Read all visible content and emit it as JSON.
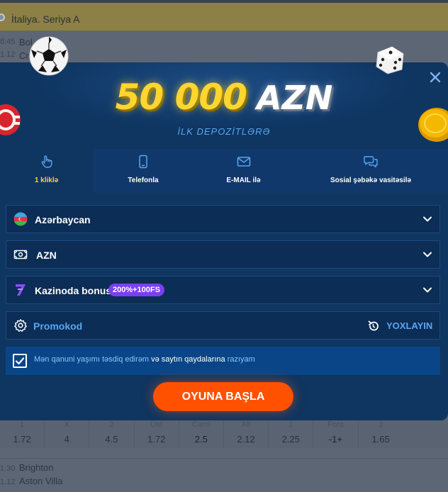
{
  "background": {
    "league": "İtaliya. Seriya A",
    "match1": {
      "times": [
        "8:45",
        "1.12"
      ],
      "teams": [
        "Bol",
        "Cr"
      ]
    },
    "odds": [
      {
        "head": "1",
        "value": "1.72"
      },
      {
        "head": "X",
        "value": "4"
      },
      {
        "head": "2",
        "value": "4.5"
      },
      {
        "head": "Üst",
        "value": "1.72"
      },
      {
        "head": "Cəmi",
        "value": "2.5"
      },
      {
        "head": "Alt",
        "value": "2.12"
      },
      {
        "head": "1",
        "value": "2.25"
      },
      {
        "head": "Fora",
        "value": "-1+"
      },
      {
        "head": "2",
        "value": "1.65"
      }
    ],
    "match2": {
      "times": [
        "1:30",
        "1.12"
      ],
      "teams": [
        "Brighton",
        "Aston Villa"
      ]
    }
  },
  "modal": {
    "close_icon": "close-icon",
    "headline": {
      "amount": "50 000",
      "currency": "AZN"
    },
    "subhead": "İLK DEPOZİTLƏRƏ",
    "tabs": [
      {
        "label": "1 kliklə",
        "icon": "hand-pointer-icon",
        "active": true
      },
      {
        "label": "Telefonla",
        "icon": "phone-icon",
        "active": false
      },
      {
        "label": "E-MAIL ilə",
        "icon": "mail-icon",
        "active": false
      },
      {
        "label": "Sosial şəbəkə vasitəsilə",
        "icon": "chat-icon",
        "active": false
      }
    ],
    "country": {
      "value": "Azərbaycan",
      "icon": "azerbaijan-flag-icon"
    },
    "currency_select": {
      "value": "AZN",
      "icon": "banknote-icon"
    },
    "bonus": {
      "label": "Kazinoda bonus",
      "badge": "200%+100FS",
      "icon": "casino-7-icon"
    },
    "promo": {
      "placeholder": "Promokod",
      "check_label": "YOXLAYIN",
      "icon": "gear-icon"
    },
    "consent": {
      "checked": true,
      "part1": "Mən qanuni yaşımı təsdiq edirəm",
      "part2": " və ",
      "part3": "saytın qaydalarına",
      "part4": " razıyam"
    },
    "cta": "OYUNA BAŞLA"
  },
  "colors": {
    "modal_bg": "#0f3561",
    "accent_yellow": "#ffd530",
    "link_blue": "#5aa6f2",
    "cta_orange": "#ff5100",
    "badge_purple": "#7c3ff0"
  }
}
